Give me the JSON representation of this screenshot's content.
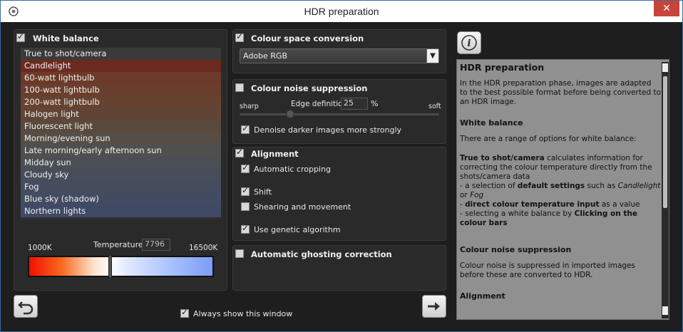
{
  "window": {
    "title": "HDR preparation",
    "close_label": "✕"
  },
  "white_balance": {
    "title": "White balance",
    "checked": true,
    "items": [
      {
        "label": "True to shot/camera",
        "color": "#3a3a3a"
      },
      {
        "label": "Candlelight",
        "color": "#6b2a20"
      },
      {
        "label": "60-watt lightbulb",
        "color": "#6b3a28"
      },
      {
        "label": "100-watt lightbulb",
        "color": "#6a3e2c"
      },
      {
        "label": "200-watt lightbulb",
        "color": "#664230"
      },
      {
        "label": "Halogen light",
        "color": "#604536"
      },
      {
        "label": "Fluorescent light",
        "color": "#5a4a3e"
      },
      {
        "label": "Morning/evening sun",
        "color": "#554d46"
      },
      {
        "label": "Late morning/early afternoon sun",
        "color": "#4f4f4f"
      },
      {
        "label": "Midday sun",
        "color": "#4a4e55"
      },
      {
        "label": "Cloudy sky",
        "color": "#474d5a"
      },
      {
        "label": "Fog",
        "color": "#444c5e"
      },
      {
        "label": "Blue sky (shadow)",
        "color": "#424b62"
      },
      {
        "label": "Northern lights",
        "color": "#3f4a66"
      }
    ],
    "temp_min": "1000K",
    "temp_max": "16500K",
    "temp_label": "Temperature",
    "temp_value": "7796"
  },
  "colour_space": {
    "title": "Colour space conversion",
    "checked": true,
    "value": "Adobe RGB"
  },
  "noise": {
    "title": "Colour noise suppression",
    "checked": false,
    "sharp_label": "sharp",
    "soft_label": "soft",
    "edge_label": "Edge definition",
    "edge_value": "25",
    "percent": "%",
    "denoise_label": "Denoise darker images more strongly",
    "denoise_checked": true
  },
  "alignment": {
    "title": "Alignment",
    "checked": true,
    "options": [
      {
        "label": "Automatic cropping",
        "checked": true
      },
      {
        "label": "Shift",
        "checked": true
      },
      {
        "label": "Shearing and movement",
        "checked": false
      },
      {
        "label": "Use genetic algorithm",
        "checked": true
      }
    ]
  },
  "ghosting": {
    "title": "Automatic ghosting correction",
    "checked": false
  },
  "footer": {
    "always_show_label": "Always show this window",
    "always_show_checked": true,
    "back_icon": "undo-icon",
    "next_icon": "arrow-right-icon"
  },
  "help": {
    "info_icon": "info-icon",
    "h_main": "HDR preparation",
    "p_main": "In the HDR preparation phase, images are adapted to the best possible format before being converted to an HDR image.",
    "h_wb": "White balance",
    "p_wb": "There are a range of options for white balance:",
    "li1_bold": "True to shot/camera",
    "li1_rest": " calculates information for correcting the colour temperature directly from the shots/camera data",
    "li2_pre": "- a selection of ",
    "li2_bold": "default settings",
    "li2_mid": " such as ",
    "li2_it1": "Candlelight",
    "li2_or": " or ",
    "li2_it2": "Fog",
    "li3_pre": "- ",
    "li3_bold": "direct colour temperature input",
    "li3_rest": " as a value",
    "li4_pre": "- selecting a white balance by ",
    "li4_bold": "Clicking on the colour bars",
    "h_noise": "Colour noise suppression",
    "p_noise": "Colour noise is suppressed in imported images before these are converted to HDR.",
    "h_align": "Alignment"
  }
}
